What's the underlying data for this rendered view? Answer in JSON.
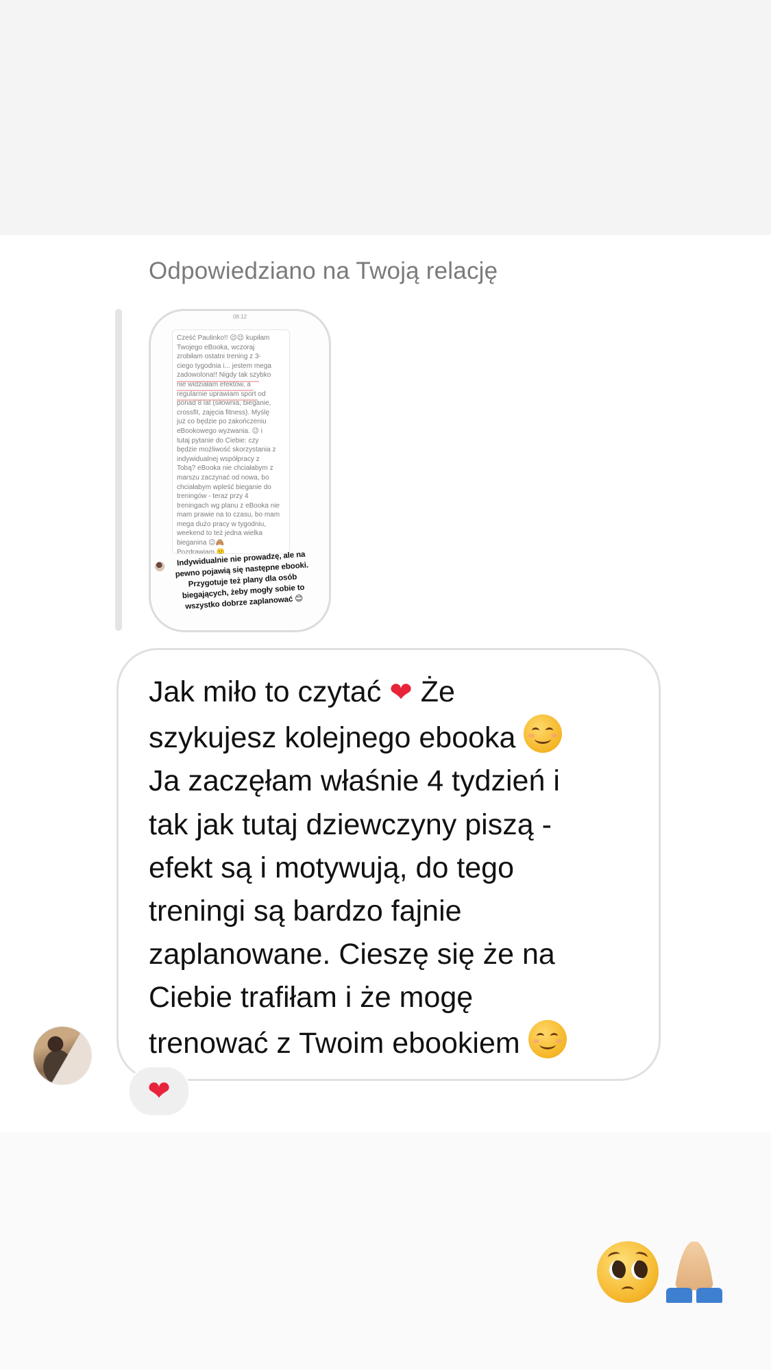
{
  "reply": {
    "caption": "Odpowiedziano na Twoją relację"
  },
  "story": {
    "time": "08:12",
    "card_text": "Cześć Paulinko!! 😉😉 kupiłam\nTwojego eBooka, wczoraj\nzrobiłam ostatni trening z 3-\nciego tygodnia i... jestem mega\nzadowolona!! Nigdy tak szybko\nnie widziałam efektów, a\nregularnie uprawiam sport od\nponad 8 lat (siłownia, bieganie,\ncrossfit, zajęcia fitness). Myślę\njuż co będzie po zakończeniu\neBookowego wyzwania. 😉 i\ntutaj pytanie do Ciebie: czy\nbędzie możliwość skorzystania z\nindywidualnej współpracy z\nTobą? eBooka nie chciałabym z\nmarszu zaczynać od nowa, bo\nchciałabym wpleść bieganie do\ntreningów - teraz przy 4\ntreningach wg planu z eBooka nie\nmam prawie na to czasu, bo mam\nmega dużo pracy w tygodniu,\nweekend to też jedna wielka\nbieganina 😉🙈\nPozdrawiam 🙂",
    "overlay_reply": "Indywidualnie nie prowadzę, ale na\npewno pojawią się  następne ebooki.\nPrzygotuje też plany dla osób\nbiegających, żeby mogły sobie to\nwszystko dobrze zaplanować 😊"
  },
  "message": {
    "part1": "Jak miło to czytać ",
    "heart": "❤",
    "part2": "  Że\nszykujesz kolejnego ebooka ",
    "part3": "\nJa zaczęłam właśnie 4 tydzień i\ntak jak tutaj dziewczyny piszą -\nefekt są i motywują, do tego\ntreningi są bardzo fajnie\nzaplanowane. Cieszę się że na\nCiebie trafiłam i że mogę\ntrenować z Twoim ebookiem "
  },
  "reaction": {
    "emoji": "❤"
  },
  "footer_emojis": [
    "pleading-face-icon",
    "folded-hands-icon"
  ],
  "colors": {
    "heart": "#e8243a",
    "caption": "#7a7a7a",
    "bubble_border": "#e0e0e0",
    "reaction_bg": "#efefef"
  }
}
